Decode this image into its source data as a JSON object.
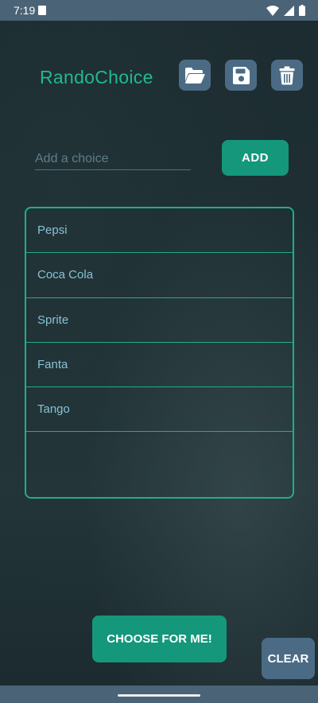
{
  "status_bar": {
    "time": "7:19",
    "icons": [
      "sd-card-icon",
      "wifi-icon",
      "signal-icon",
      "battery-icon"
    ]
  },
  "app": {
    "title": "RandoChoice",
    "toolbar": {
      "open_icon": "folder-open-icon",
      "save_icon": "floppy-disk-icon",
      "delete_icon": "trash-icon"
    }
  },
  "input": {
    "placeholder": "Add a choice",
    "value": ""
  },
  "add_button": {
    "label": "ADD"
  },
  "choices": [
    {
      "label": "Pepsi"
    },
    {
      "label": "Coca Cola"
    },
    {
      "label": "Sprite"
    },
    {
      "label": "Fanta"
    },
    {
      "label": "Tango"
    }
  ],
  "choose_button": {
    "label": "CHOOSE FOR ME!"
  },
  "clear_button": {
    "label": "CLEAR"
  },
  "colors": {
    "accent": "#21b98d",
    "button_green": "#14977a",
    "button_blue": "#4b6b85",
    "status_bar": "#4b6377",
    "list_text": "#88c2d6"
  }
}
